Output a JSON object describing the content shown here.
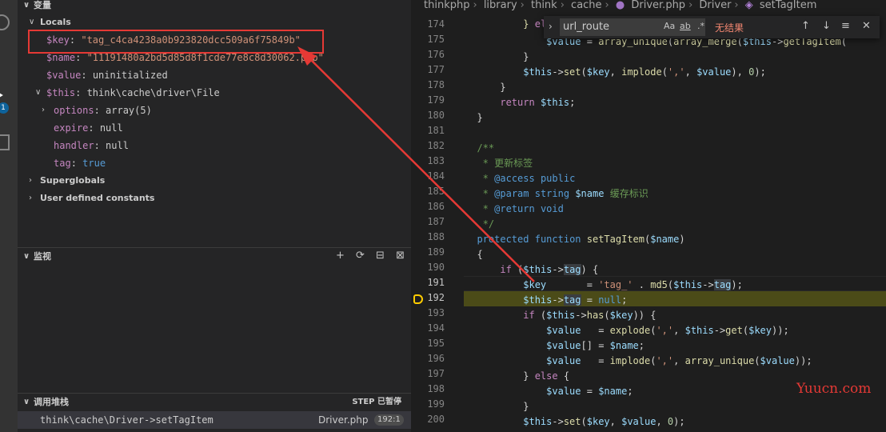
{
  "sidebar": {
    "variables_title": "变量",
    "locals_label": "Locals",
    "locals": [
      {
        "name": "$key",
        "value": "\"tag_c4ca4238a0b923820dcc509a6f75849b\""
      },
      {
        "name": "$name",
        "value": "\"11191480a2bd5d85d8f1cde77e8c8d30062.php\""
      },
      {
        "name": "$value",
        "value": "uninitialized"
      },
      {
        "name": "$this",
        "value": "think\\cache\\driver\\File"
      }
    ],
    "this_children": [
      {
        "name": "options",
        "value": "array(5)"
      },
      {
        "name": "expire",
        "value": "null"
      },
      {
        "name": "handler",
        "value": "null"
      },
      {
        "name": "tag",
        "value": "true"
      }
    ],
    "superglobals_label": "Superglobals",
    "user_constants_label": "User defined constants",
    "watch_title": "监视",
    "callstack_title": "调用堆栈",
    "step_status": "STEP 已暂停",
    "stack_frame": {
      "name": "think\\cache\\Driver->setTagItem",
      "file": "Driver.php",
      "pos": "192:1"
    },
    "badge_count": "1"
  },
  "breadcrumb": [
    "thinkphp",
    "library",
    "think",
    "cache",
    "Driver.php",
    "Driver",
    "setTagItem"
  ],
  "find": {
    "value": "url_route",
    "case_label": "Aa",
    "word_label": "ab",
    "regex_label": ".*",
    "no_results": "无结果"
  },
  "editor": {
    "current_line": 191,
    "stopped_line": 192,
    "line_numbers": [
      174,
      175,
      176,
      177,
      178,
      179,
      180,
      181,
      182,
      183,
      184,
      185,
      186,
      187,
      188,
      189,
      190,
      191,
      192,
      193,
      194,
      195,
      196,
      197,
      198,
      199,
      200
    ]
  },
  "watermark": "Yuucn.com",
  "colors": {
    "accent": "#0e639c",
    "highlight_box": "#e53935",
    "stopped_line_bg": "#4b4b18"
  }
}
